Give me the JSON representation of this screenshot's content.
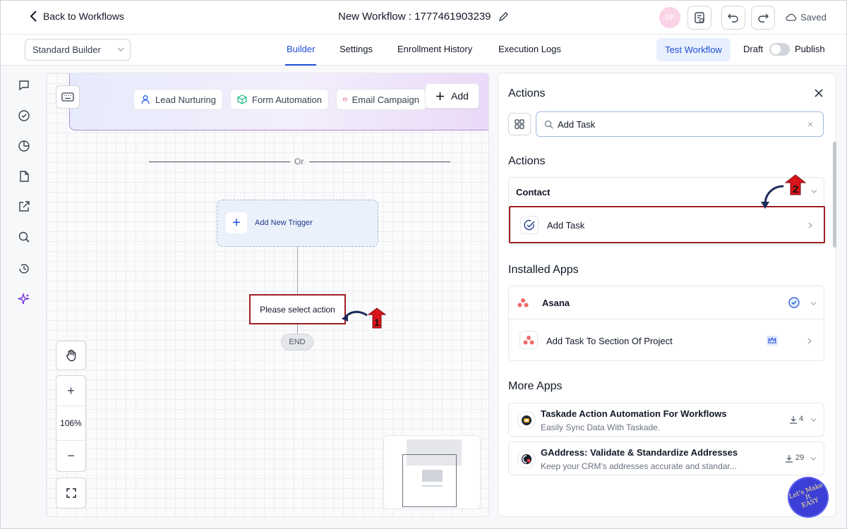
{
  "header": {
    "back_label": "Back to Workflows",
    "workflow_title": "New Workflow : 1777461903239",
    "avatar_initials": "SP",
    "saved_label": "Saved"
  },
  "subbar": {
    "builder_select": "Standard Builder",
    "tabs": [
      {
        "label": "Builder",
        "active": true
      },
      {
        "label": "Settings",
        "active": false
      },
      {
        "label": "Enrollment History",
        "active": false
      },
      {
        "label": "Execution Logs",
        "active": false
      }
    ],
    "test_button": "Test Workflow",
    "draft_label": "Draft",
    "publish_label": "Publish",
    "publish_toggle_on": false
  },
  "sidebar": {
    "icons": [
      "chat-icon",
      "check-circle-icon",
      "pie-chart-icon",
      "document-icon",
      "external-link-icon",
      "search-icon",
      "history-icon",
      "sparkles-icon"
    ]
  },
  "canvas": {
    "chips": [
      "Lead Nurturing",
      "Form Automation",
      "Email Campaign"
    ],
    "add_label": "Add",
    "or_label": "Or",
    "add_trigger_label": "Add New Trigger",
    "action_placeholder": "Please select action",
    "end_label": "END",
    "zoom_plus": "+",
    "zoom_level": "106%",
    "zoom_minus": "−",
    "annotation_1": "1"
  },
  "panel": {
    "title": "Actions",
    "search_value": "Add Task",
    "actions_section": "Actions",
    "contact_group": "Contact",
    "add_task_item": "Add Task",
    "annotation_2": "2",
    "installed_section": "Installed Apps",
    "asana_name": "Asana",
    "asana_action": "Add Task To Section Of Project",
    "more_section": "More Apps",
    "more_apps": [
      {
        "name": "Taskade Action Automation For Workflows",
        "desc": "Easily Sync Data With Taskade.",
        "downloads": "4"
      },
      {
        "name": "GAddress: Validate & Standardize Addresses",
        "desc": "Keep your CRM's addresses accurate and standar...",
        "downloads": "29"
      }
    ]
  },
  "fab": {
    "line1": "Let's Make",
    "line2": "It",
    "line3": "EASY"
  },
  "colors": {
    "accent": "#1d4ed8",
    "highlight_border": "#a01f24",
    "annotation_red": "#d9141a",
    "arrow_navy": "#1e2a5a"
  }
}
